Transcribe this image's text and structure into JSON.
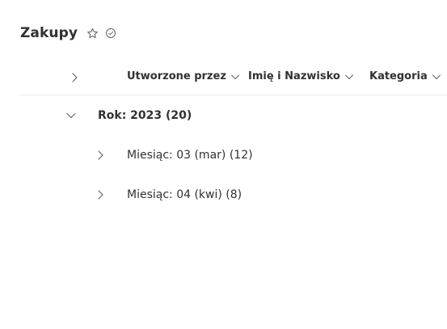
{
  "list": {
    "title": "Zakupy"
  },
  "header": {
    "columns": [
      {
        "label": "Utworzone przez"
      },
      {
        "label": "Imię i Nazwisko"
      },
      {
        "label": "Kategoria"
      }
    ]
  },
  "groups": [
    {
      "label": "Rok: 2023 (20)",
      "subgroups": [
        {
          "label": "Miesiąc: 03 (mar) (12)"
        },
        {
          "label": "Miesiąc: 04 (kwi) (8)"
        }
      ]
    }
  ],
  "icons": {
    "favorite": "star-outline-icon",
    "status": "check-circle-icon",
    "expand": "chevron-right-icon",
    "collapse": "chevron-down-icon"
  },
  "colors": {
    "text": "#323130",
    "icon": "#605e5c",
    "divider": "#edebe9"
  }
}
